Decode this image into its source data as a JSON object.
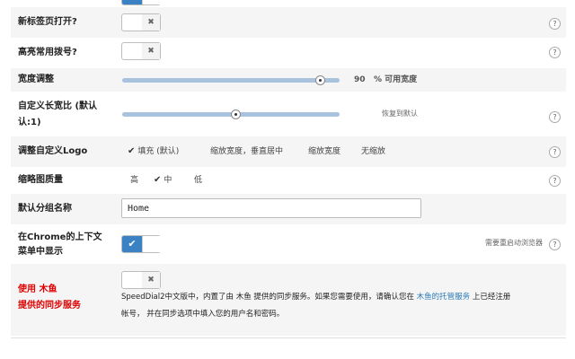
{
  "rows": {
    "new_tab": {
      "label": "新标签页打开?",
      "toggle_state": "off",
      "toggle_mark": "✖"
    },
    "highlight": {
      "label": "高亮常用拨号?",
      "toggle_state": "off",
      "toggle_mark": "✖"
    },
    "width": {
      "label": "宽度调整",
      "value": 90,
      "value_text": "90",
      "unit_text": "% 可用宽度"
    },
    "aspect": {
      "label_line1": "自定义长宽比 (默认",
      "label_line2": "认:1)",
      "reset_text": "恢复到默认",
      "value_fraction": 0.5
    },
    "logo": {
      "label": "调整自定义Logo",
      "options": [
        "填充 (默认)",
        "缩放宽度，垂直居中",
        "缩放宽度",
        "无缩放"
      ],
      "selected": "填充 (默认)"
    },
    "thumb_quality": {
      "label": "缩略图质量",
      "options": [
        "高",
        "中",
        "低"
      ],
      "selected": "中"
    },
    "group_name": {
      "label": "默认分组名称",
      "value": "Home"
    },
    "context_menu": {
      "label_line1": "在Chrome的上下文",
      "label_line2": "菜单中显示",
      "toggle_state": "on",
      "toggle_mark": "✔",
      "note": "需要重启动浏览器"
    },
    "sync": {
      "label_line1": "使用 木鱼",
      "label_line2": "提供的同步服务",
      "toggle_state": "off",
      "toggle_mark": "✖",
      "desc_part1": "SpeedDial2中文版中，内置了由 木鱼 提供的同步服务。如果您需要使用，请确认您在",
      "desc_link": "木鱼的托管服务",
      "desc_part2": "上已经注册",
      "desc_line2": "帐号， 并在同步选项中填入您的用户名和密码。"
    }
  },
  "help_glyph": "?",
  "check_glyph": "✔",
  "colors": {
    "accent": "#3b82c4",
    "slider": "#a9c3df",
    "alt_row": "#f5f5f5",
    "red_label": "#e00000",
    "link": "#2a7ab8"
  }
}
